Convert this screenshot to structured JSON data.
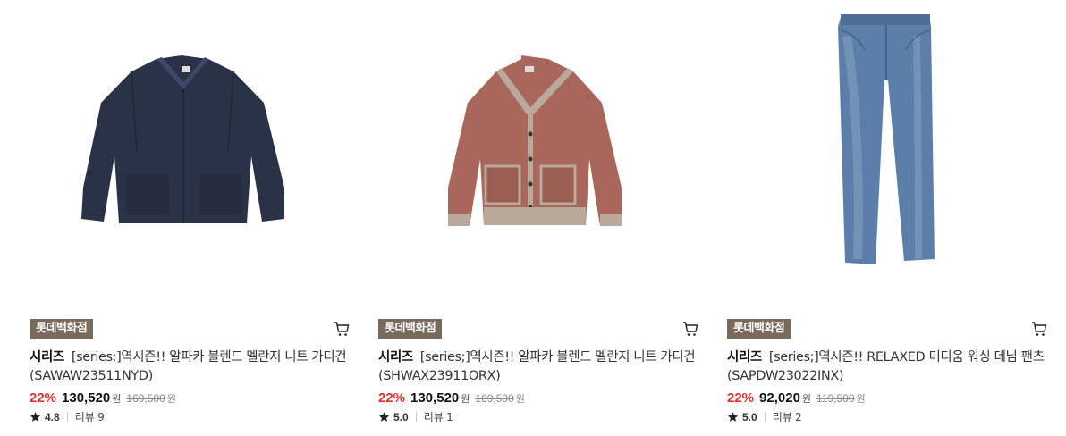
{
  "products": [
    {
      "badge": "롯데백화점",
      "brand": "시리즈",
      "name": "[series;]역시즌!! 알파카 블렌드 멜란지 니트 가디건(SAWAW23511NYD)",
      "discount": "22%",
      "price": "130,520",
      "currency": "원",
      "original_price": "169,500",
      "original_currency": "원",
      "rating": "4.8",
      "review_label": "리뷰",
      "review_count": "9",
      "image_icon": "navy-cardigan-image",
      "colors": {
        "body": "#2a3247",
        "shade": "#1e2536"
      }
    },
    {
      "badge": "롯데백화점",
      "brand": "시리즈",
      "name": "[series;]역시즌!! 알파카 블렌드 멜란지 니트 가디건(SHWAX23911ORX)",
      "discount": "22%",
      "price": "130,520",
      "currency": "원",
      "original_price": "169,500",
      "original_currency": "원",
      "rating": "5.0",
      "review_label": "리뷰",
      "review_count": "1",
      "image_icon": "rust-cardigan-image",
      "colors": {
        "body": "#a8675a",
        "trim": "#b9a99a"
      }
    },
    {
      "badge": "롯데백화점",
      "brand": "시리즈",
      "name": "[series;]역시즌!! RELAXED 미디움 워싱 데님 팬츠(SAPDW23022INX)",
      "discount": "22%",
      "price": "92,020",
      "currency": "원",
      "original_price": "119,500",
      "original_currency": "원",
      "rating": "5.0",
      "review_label": "리뷰",
      "review_count": "2",
      "image_icon": "denim-pants-image",
      "colors": {
        "body": "#5b7fa8",
        "fade": "#8aa6c4"
      }
    }
  ],
  "icons": {
    "cart": "cart-icon",
    "star": "star-icon"
  },
  "colors": {
    "badge_bg": "#7a6a5c",
    "discount": "#e0312b"
  }
}
